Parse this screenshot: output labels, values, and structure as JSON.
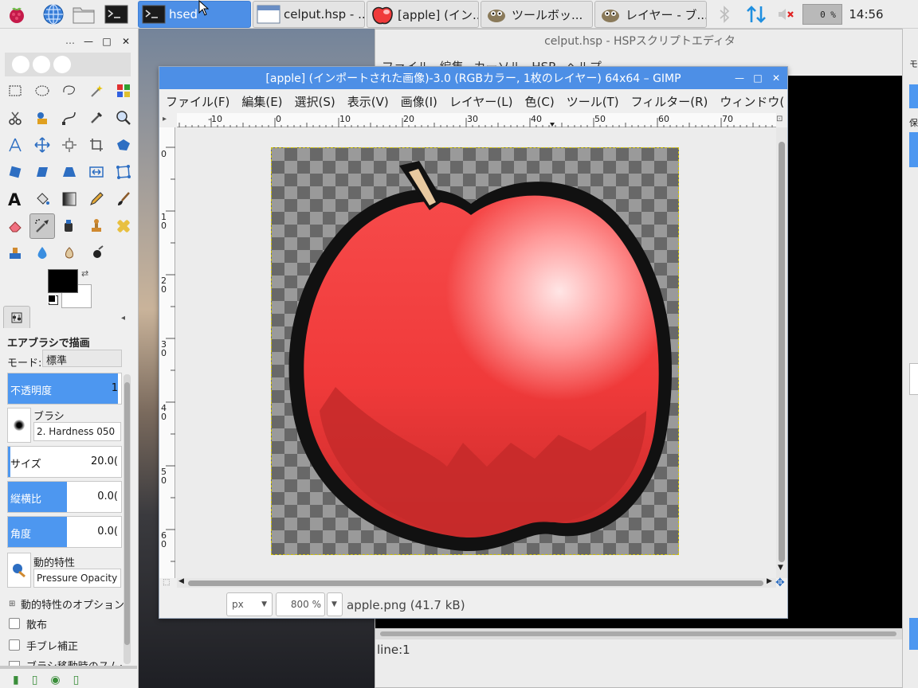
{
  "taskbar": {
    "tasks": [
      {
        "label": "hsed",
        "icon": "terminal-icon"
      },
      {
        "label": "celput.hsp - ...",
        "icon": "window-icon"
      },
      {
        "label": "[apple] (イン...",
        "icon": "apple-icon"
      },
      {
        "label": "ツールボッ...",
        "icon": "gimp-icon"
      },
      {
        "label": "レイヤー - ブ...",
        "icon": "gimp-icon"
      }
    ],
    "cpu_label": "0 %",
    "clock": "14:56"
  },
  "hsp_editor": {
    "title": "celput.hsp - HSPスクリプトエディタ",
    "menu": "ファイル 編集 カーソル HSP ヘルプ",
    "status": "line:1"
  },
  "gimp_window": {
    "title": "[apple] (インポートされた画像)-3.0 (RGBカラー, 1枚のレイヤー) 64x64 – GIMP",
    "menu": [
      "ファイル(F)",
      "編集(E)",
      "選択(S)",
      "表示(V)",
      "画像(I)",
      "レイヤー(L)",
      "色(C)",
      "ツール(T)",
      "フィルター(R)",
      "ウィンドウ("
    ],
    "hruler_labels": [
      "-10",
      "0",
      "10",
      "20",
      "30",
      "40",
      "50",
      "60",
      "70"
    ],
    "vruler_labels": [
      "0",
      "10",
      "20",
      "30",
      "40",
      "50",
      "60"
    ],
    "unit": "px",
    "zoom": "800 %",
    "file_info": "apple.png (41.7 kB)"
  },
  "tool_options": {
    "title": "エアブラシで描画",
    "mode_label": "モード:",
    "mode_value": "標準",
    "opacity_label": "不透明度",
    "opacity_value": "1",
    "opacity_fraction": 0.97,
    "brush_label": "ブラシ",
    "brush_value": "2. Hardness 050",
    "size_label": "サイズ",
    "size_value": "20.0(",
    "size_fraction": 0.02,
    "aspect_label": "縦横比",
    "aspect_value": "0.0(",
    "aspect_fraction": 0.5,
    "angle_label": "角度",
    "angle_value": "0.0(",
    "angle_fraction": 0.5,
    "dynamics_label": "動的特性",
    "dynamics_value": "Pressure Opacity",
    "dynamics_options": "動的特性のオプション",
    "scatter_label": "散布",
    "jitter_label": "手ブレ補正",
    "cut_label": "ブラシ移動時のスムー"
  },
  "colors": {
    "accent": "#4d8fe6",
    "foreground": "#000000",
    "background": "#ffffff",
    "apple_red": "#f04040"
  }
}
